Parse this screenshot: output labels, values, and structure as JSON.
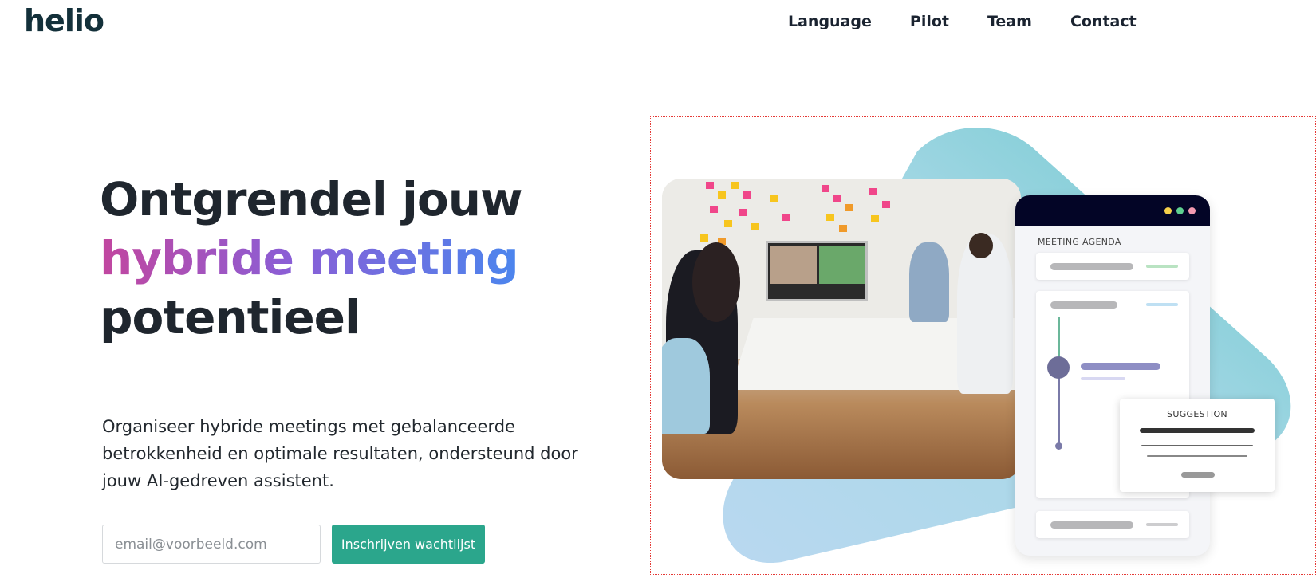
{
  "header": {
    "logo_text": "helio",
    "nav": [
      {
        "label": "Language"
      },
      {
        "label": "Pilot"
      },
      {
        "label": "Team"
      },
      {
        "label": "Contact"
      }
    ]
  },
  "hero": {
    "headline_line1": "Ontgrendel jouw",
    "headline_line2": "hybride meeting",
    "headline_line3": "potentieel",
    "subtext": "Organiseer hybride meetings met gebalanceerde betrokkenheid en optimale resultaten, ondersteund door jouw AI-gedreven assistent.",
    "email_placeholder": "email@voorbeeld.com",
    "email_value": "",
    "cta_label": "Inschrijven wachtlijst"
  },
  "illustration": {
    "agenda_title": "MEETING AGENDA",
    "suggestion_title": "SUGGESTION"
  },
  "colors": {
    "accent": "#2ba68c",
    "headline_gradient": [
      "#c2469f",
      "#8a5ed6",
      "#4a86ee"
    ],
    "agenda_header": "#030526"
  }
}
